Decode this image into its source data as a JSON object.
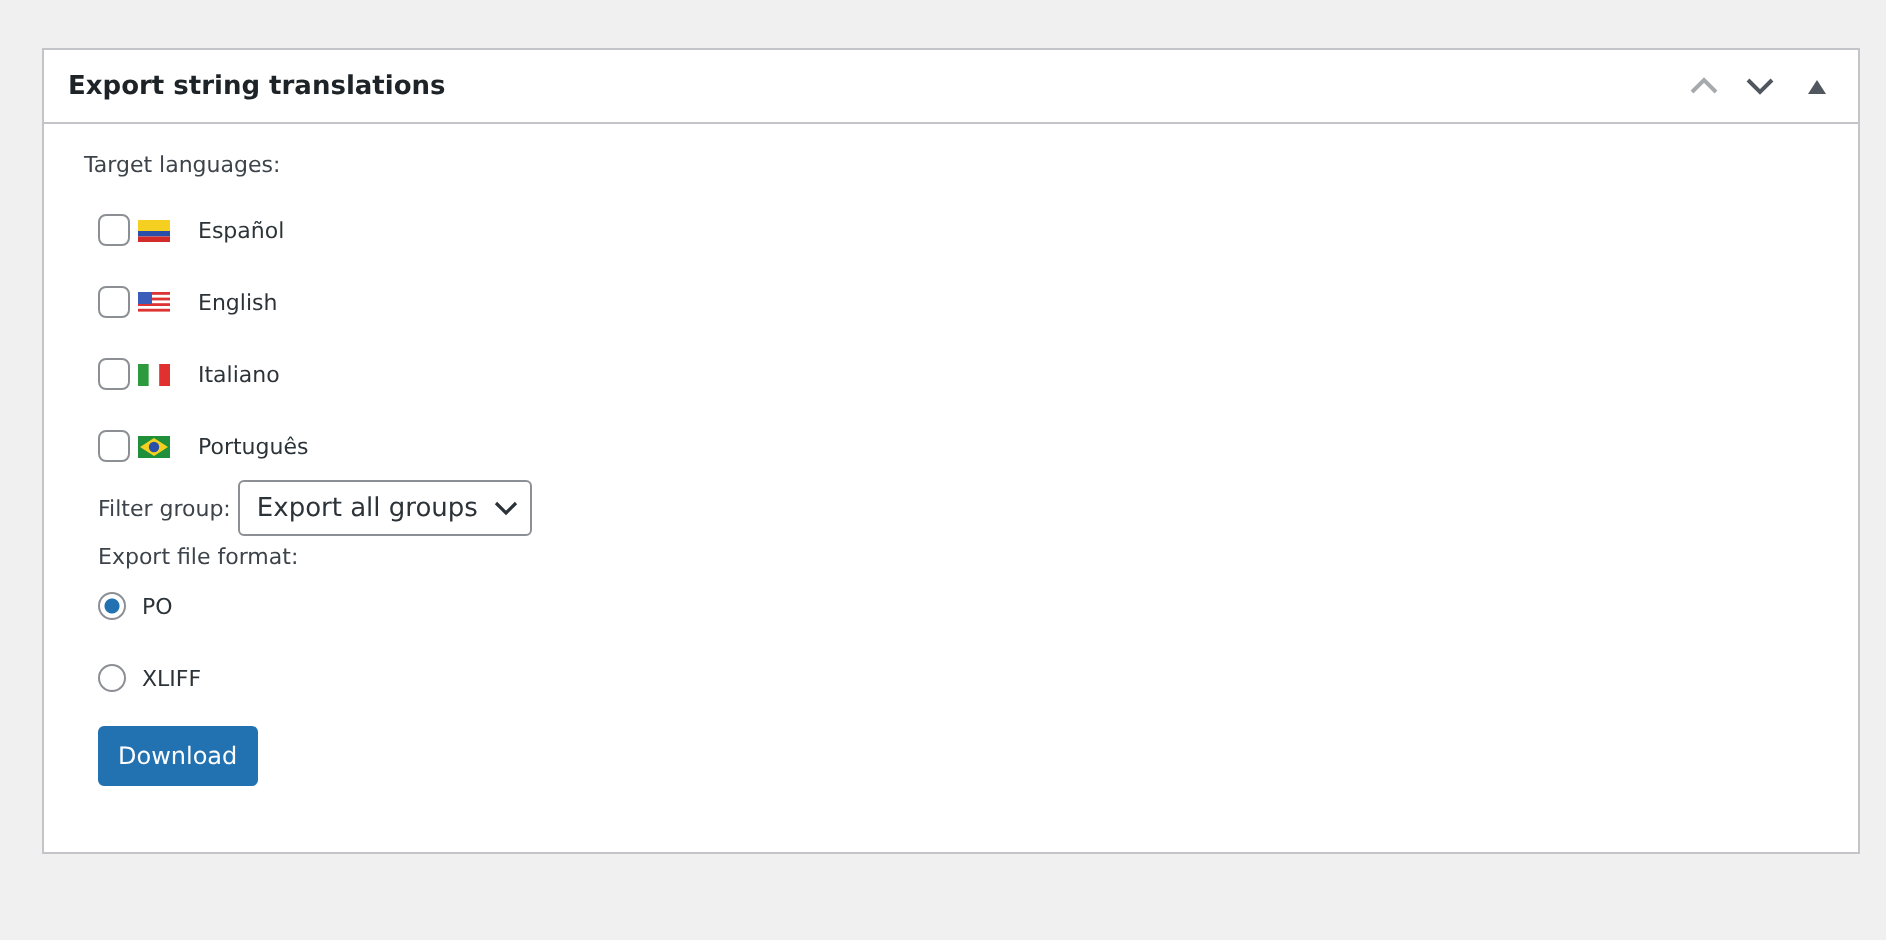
{
  "panel": {
    "title": "Export string translations",
    "controls": [
      {
        "kind": "up",
        "disabled": true
      },
      {
        "kind": "down",
        "disabled": false
      },
      {
        "kind": "toggle",
        "disabled": false
      }
    ]
  },
  "target_languages": {
    "label": "Target languages:",
    "items": [
      {
        "label": "Español",
        "kind": "colombia",
        "checked": false
      },
      {
        "label": "English",
        "kind": "usa",
        "checked": false
      },
      {
        "label": "Italiano",
        "kind": "italy",
        "checked": false
      },
      {
        "label": "Português",
        "kind": "brazil",
        "checked": false
      }
    ]
  },
  "filter_group": {
    "label": "Filter group:",
    "value": "Export all groups"
  },
  "export_format": {
    "label": "Export file format:",
    "options": [
      {
        "label": "PO",
        "selected": true
      },
      {
        "label": "XLIFF",
        "selected": false
      }
    ]
  },
  "buttons": [
    "Download"
  ]
}
